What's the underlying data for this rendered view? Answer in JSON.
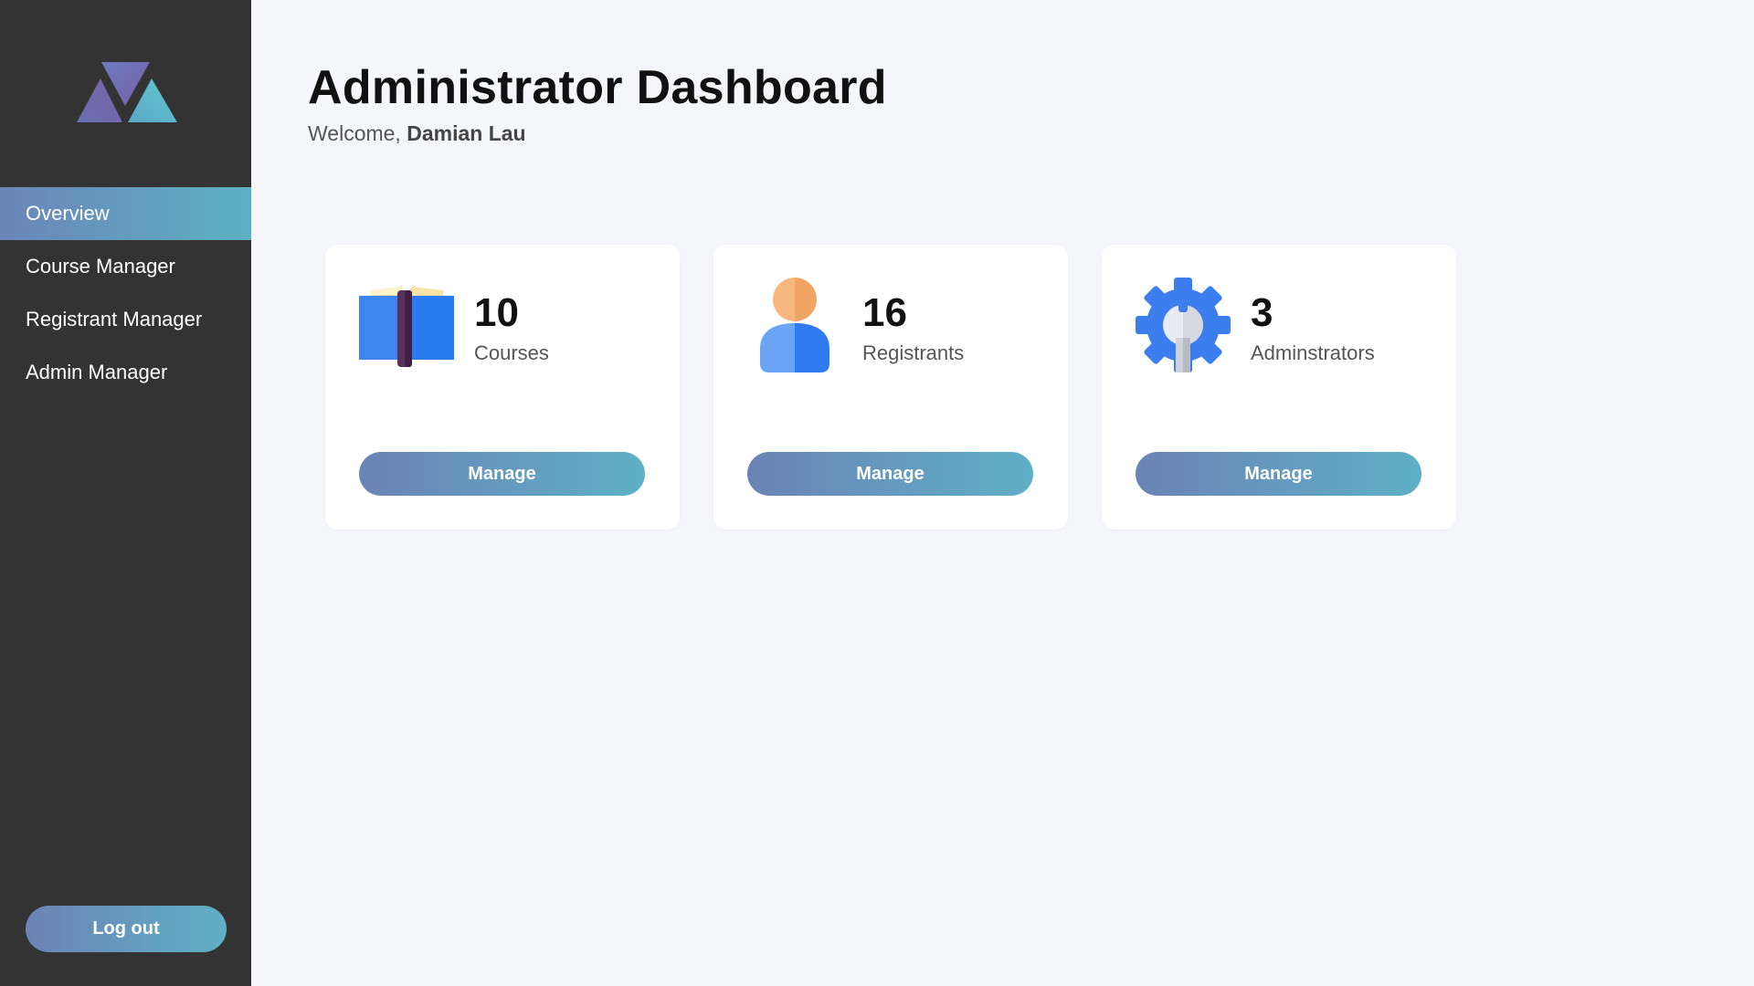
{
  "sidebar": {
    "logo_icon": "triangle-logo-icon",
    "items": [
      {
        "label": "Overview",
        "active": true
      },
      {
        "label": "Course Manager",
        "active": false
      },
      {
        "label": "Registrant Manager",
        "active": false
      },
      {
        "label": "Admin Manager",
        "active": false
      }
    ],
    "logout_label": "Log out"
  },
  "header": {
    "title": "Administrator Dashboard",
    "welcome_prefix": "Welcome, ",
    "user_name": "Damian Lau"
  },
  "cards": [
    {
      "count": "10",
      "label": "Courses",
      "icon": "book-icon",
      "button": "Manage"
    },
    {
      "count": "16",
      "label": "Registrants",
      "icon": "user-icon",
      "button": "Manage"
    },
    {
      "count": "3",
      "label": "Adminstrators",
      "icon": "gear-wrench-icon",
      "button": "Manage"
    }
  ],
  "colors": {
    "sidebar_bg": "#333333",
    "page_bg": "#f5f6fa",
    "accent_start": "#6b83b6",
    "accent_end": "#5fb0c6"
  }
}
